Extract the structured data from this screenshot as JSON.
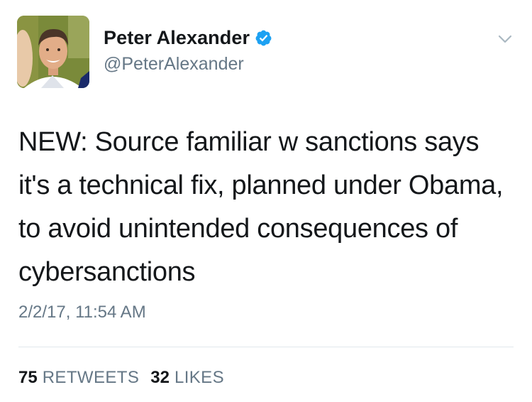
{
  "author": {
    "display_name": "Peter Alexander",
    "handle": "@PeterAlexander",
    "verified": true,
    "verified_badge_color": "#1da1f2"
  },
  "tweet": {
    "text": "NEW: Source familiar w sanctions says it's a technical fix, planned under Obama, to avoid unintended consequences of cybersanctions",
    "timestamp": "2/2/17, 11:54 AM"
  },
  "stats": {
    "retweets_count": "75",
    "retweets_label": "RETWEETS",
    "likes_count": "32",
    "likes_label": "LIKES"
  },
  "icons": {
    "menu": "chevron-down-icon",
    "verified": "verified-badge-icon"
  }
}
